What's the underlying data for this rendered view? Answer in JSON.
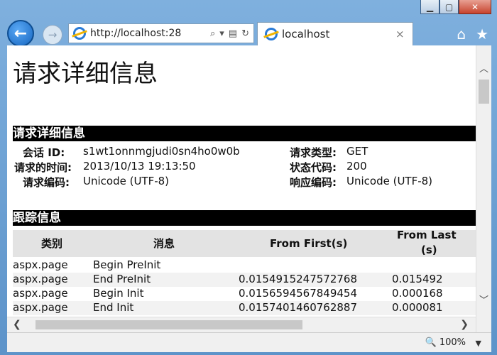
{
  "browser": {
    "address": "http://localhost:28",
    "tab_title": "localhost",
    "tab_close": "×",
    "zoom": "100%"
  },
  "page": {
    "title": "请求详细信息",
    "section_request": "请求详细信息",
    "section_trace": "跟踪信息",
    "details": {
      "session_id_label": "会话 ID:",
      "session_id_value": "s1wt1onnmgjudi0sn4ho0w0b",
      "request_time_label": "请求的时间:",
      "request_time_value": "2013/10/13 19:13:50",
      "request_encoding_label": "请求编码:",
      "request_encoding_value": "Unicode (UTF-8)",
      "request_type_label": "请求类型:",
      "request_type_value": "GET",
      "status_code_label": "状态代码:",
      "status_code_value": "200",
      "response_encoding_label": "响应编码:",
      "response_encoding_value": "Unicode (UTF-8)"
    },
    "trace": {
      "headers": [
        "类别",
        "消息",
        "From First(s)",
        "From Last",
        "(s)"
      ],
      "rows": [
        {
          "category": "aspx.page",
          "message": "Begin PreInit",
          "first": "",
          "last": ""
        },
        {
          "category": "aspx.page",
          "message": "End PreInit",
          "first": "0.0154915247572768",
          "last": "0.015492"
        },
        {
          "category": "aspx.page",
          "message": "Begin Init",
          "first": "0.0156594567849454",
          "last": "0.000168"
        },
        {
          "category": "aspx.page",
          "message": "End Init",
          "first": "0.0157401460762887",
          "last": "0.000081"
        }
      ]
    }
  },
  "icons": [
    "back-icon",
    "forward-icon",
    "ie-icon",
    "search-icon",
    "dropdown-icon",
    "compatibility-icon",
    "refresh-icon",
    "home-icon",
    "favorites-icon",
    "zoom-icon"
  ]
}
